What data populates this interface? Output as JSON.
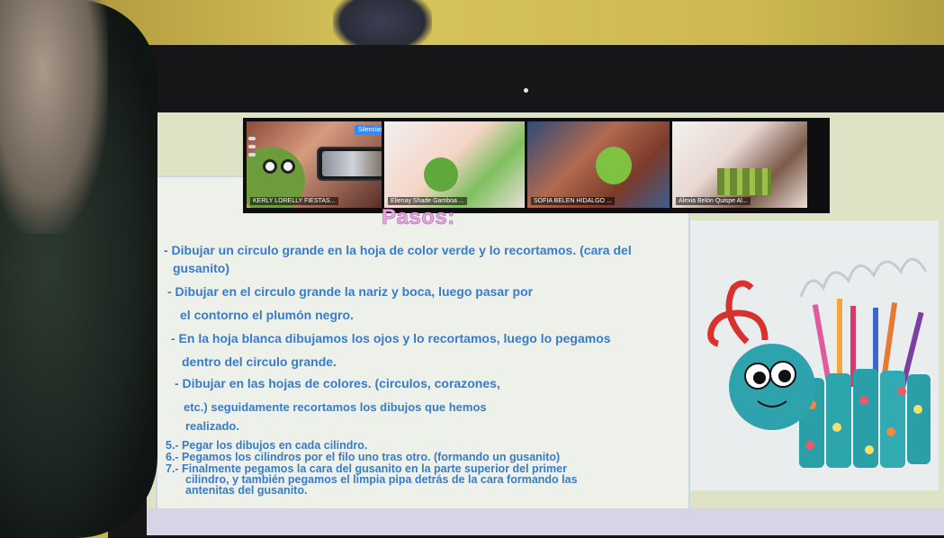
{
  "video_tiles": [
    {
      "name": "KERLY LORELLY FIESTAS..."
    },
    {
      "name": "Elienay Shade Gamboa ..."
    },
    {
      "name": "SOFIA BELEN HIDALGO ..."
    },
    {
      "name": "Alexia Belón Quispe Al..."
    }
  ],
  "controls": {
    "mute_label": "Silenciar",
    "more_label": "..."
  },
  "slide": {
    "title": "Pasos:",
    "lines": [
      "- Dibujar un circulo grande en la hoja de color verde y lo recortamos. (cara del",
      "gusanito)",
      "- Dibujar en el circulo grande  la nariz y boca, luego pasar por",
      "el contorno el plumón negro.",
      "- En la hoja blanca dibujamos los ojos y lo recortamos, luego lo pegamos",
      "dentro del circulo grande.",
      "- Dibujar en las hojas de colores. (circulos, corazones,",
      "etc.) seguidamente recortamos los dibujos que hemos",
      "realizado.",
      "5.- Pegar los dibujos en cada cilindro.",
      "6.- Pegamos los cilindros por el filo uno tras otro. (formando un gusanito)",
      "7.- Finalmente pegamos la cara del gusanito en la parte superior del primer",
      "cilindro, y también pegamos el limpia pipa detrás de la cara formando las",
      "antenitas del gusanito."
    ]
  },
  "colors": {
    "title": "#e6a6dc",
    "text": "#3a7bc8",
    "zoom_blue": "#2d8cff"
  }
}
